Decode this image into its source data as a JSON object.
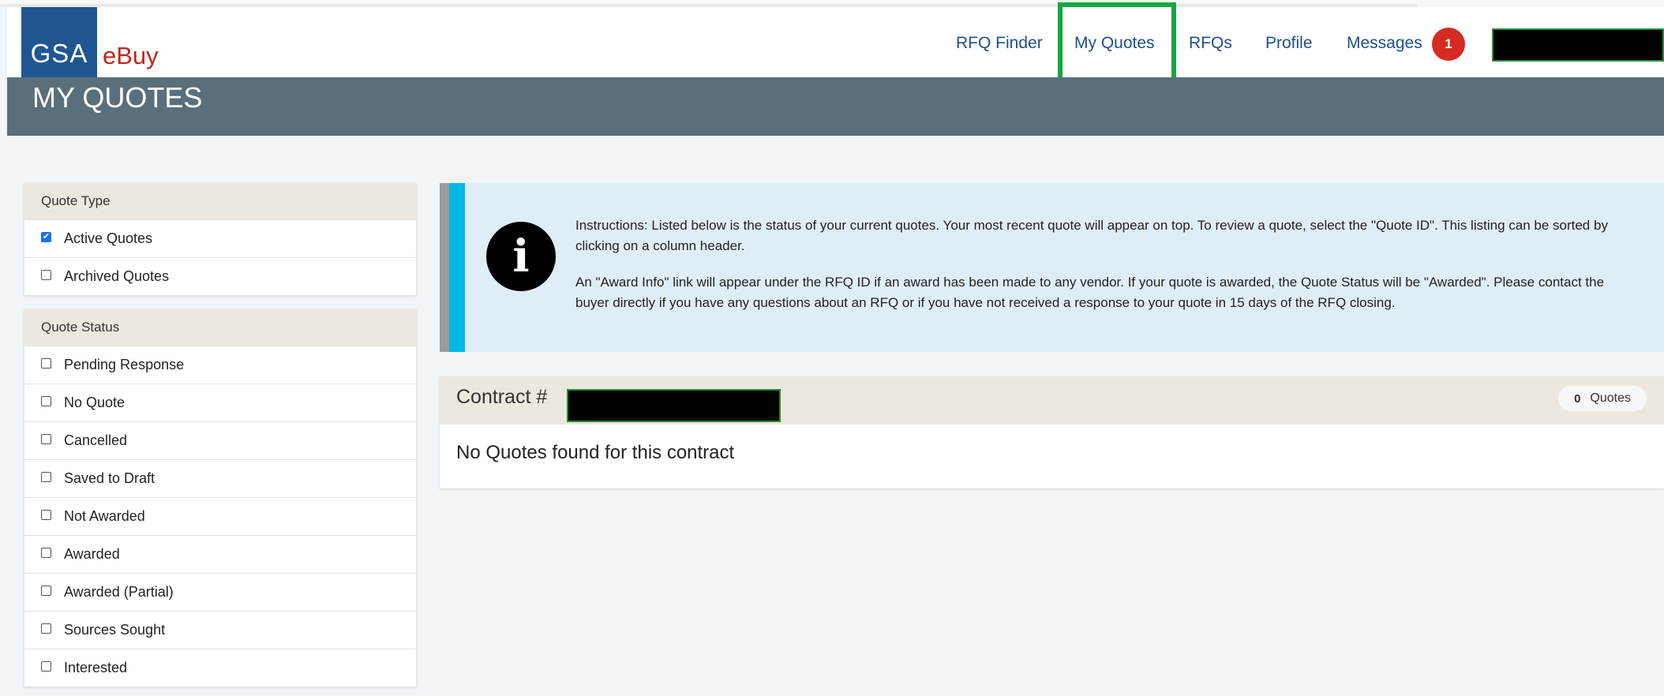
{
  "brand": {
    "logo_text": "GSA",
    "app_name": "eBuy"
  },
  "nav": {
    "items": [
      {
        "label": "RFQ Finder"
      },
      {
        "label": "My Quotes",
        "active": true
      },
      {
        "label": "RFQs"
      },
      {
        "label": "Profile"
      },
      {
        "label": "Messages"
      }
    ],
    "messages_count": "1"
  },
  "page": {
    "title": "MY QUOTES"
  },
  "quote_type": {
    "heading": "Quote Type",
    "options": [
      {
        "label": "Active Quotes",
        "checked": true
      },
      {
        "label": "Archived Quotes",
        "checked": false
      }
    ]
  },
  "quote_status": {
    "heading": "Quote Status",
    "options": [
      {
        "label": "Pending Response",
        "checked": false
      },
      {
        "label": "No Quote",
        "checked": false
      },
      {
        "label": "Cancelled",
        "checked": false
      },
      {
        "label": "Saved to Draft",
        "checked": false
      },
      {
        "label": "Not Awarded",
        "checked": false
      },
      {
        "label": "Awarded",
        "checked": false
      },
      {
        "label": "Awarded (Partial)",
        "checked": false
      },
      {
        "label": "Sources Sought",
        "checked": false
      },
      {
        "label": "Interested",
        "checked": false
      }
    ]
  },
  "instructions": {
    "paragraph1": "Instructions: Listed below is the status of your current quotes. Your most recent quote will appear on top. To review a quote, select the \"Quote ID\". This listing can be sorted by clicking on a column header.",
    "paragraph2": "An \"Award Info\" link will appear under the RFQ ID if an award has been made to any vendor. If your quote is awarded, the Quote Status will be \"Awarded\". Please contact the buyer directly if you have any questions about an RFQ or if you have not received a response to your quote in 15 days of the RFQ closing."
  },
  "contract": {
    "label": "Contract #",
    "quote_count": "0",
    "quote_count_label": "Quotes",
    "empty_message": "No Quotes found for this contract"
  },
  "colors": {
    "active_highlight": "#18a643",
    "title_bar": "#5a6f7b",
    "nav_text": "#1f4f86",
    "badge": "#d52b22",
    "info_accent": "#00b8e6"
  }
}
